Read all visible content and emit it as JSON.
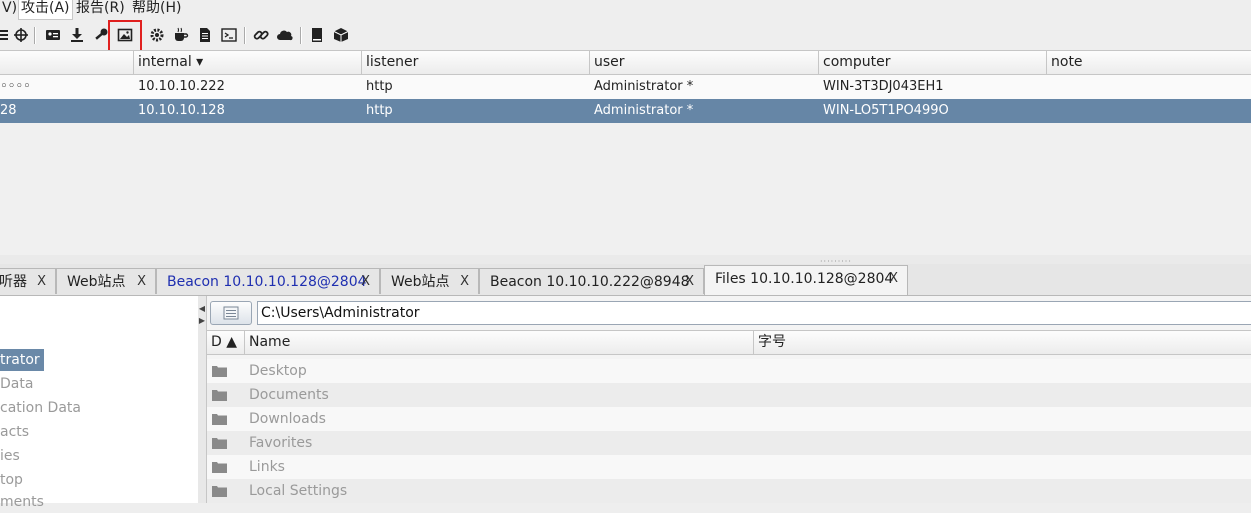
{
  "menubar": {
    "items": [
      {
        "label": "V)"
      },
      {
        "label": "攻击(A)"
      },
      {
        "label": "报告(R)"
      },
      {
        "label": "帮助(H)"
      }
    ]
  },
  "toolbar": {
    "icons": [
      "list-icon",
      "crosshair-icon",
      "id-card-icon",
      "download-icon",
      "key-icon",
      "image-icon",
      "gear-icon",
      "coffee-icon",
      "document-icon",
      "terminal-icon",
      "link-icon",
      "cloud-icon",
      "book-icon",
      "package-icon"
    ]
  },
  "sessions": {
    "columns": [
      "",
      "internal ▾",
      "listener",
      "user",
      "computer",
      "note"
    ],
    "rows": [
      {
        "external": "◦◦◦◦",
        "internal": "10.10.10.222",
        "listener": "http",
        "user": "Administrator *",
        "computer": "WIN-3T3DJ043EH1",
        "note": ""
      },
      {
        "external": "28",
        "internal": "10.10.10.128",
        "listener": "http",
        "user": "Administrator *",
        "computer": "WIN-LO5T1PO499O",
        "note": ""
      }
    ]
  },
  "tabs": [
    {
      "label": "听器",
      "close": "X"
    },
    {
      "label": "Web站点",
      "close": "X"
    },
    {
      "label": "Beacon 10.10.10.128@2804",
      "close": "X"
    },
    {
      "label": "Web站点",
      "close": "X"
    },
    {
      "label": "Beacon 10.10.10.222@8948",
      "close": "X"
    },
    {
      "label": "Files 10.10.10.128@2804",
      "close": "X"
    }
  ],
  "tree": {
    "items": [
      "trator",
      "Data",
      "cation Data",
      "acts",
      "ies",
      "top",
      "ments"
    ]
  },
  "files": {
    "path": "C:\\Users\\Administrator",
    "columns": [
      "D ▲",
      "Name",
      "字号"
    ],
    "rows": [
      "Desktop",
      "Documents",
      "Downloads",
      "Favorites",
      "Links",
      "Local Settings"
    ]
  },
  "colors": {
    "selected_row": "#6686a6",
    "highlight_box": "#e0201f",
    "active_beacon_tab": "#1f2fb0"
  }
}
